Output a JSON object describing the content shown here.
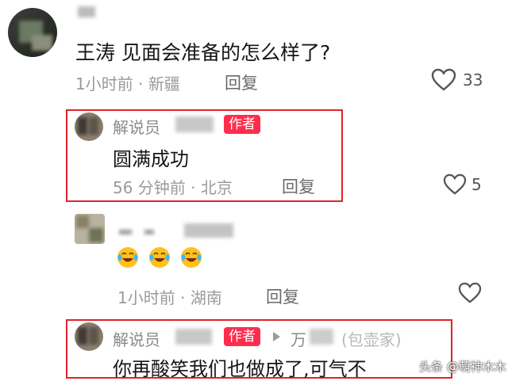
{
  "comments": [
    {
      "text": "王涛 见面会准备的怎么样了?",
      "time": "1小时前",
      "location": "新疆",
      "separator": "·",
      "reply_label": "回复",
      "likes": "33"
    },
    {
      "name": "解说员",
      "author_badge": "作者",
      "text": "圆满成功",
      "time": "56 分钟前",
      "location": "北京",
      "separator": "·",
      "reply_label": "回复",
      "likes": "5"
    },
    {
      "text_emoji_count": 3,
      "time": "1小时前",
      "location": "湖南",
      "separator": "·",
      "reply_label": "回复"
    },
    {
      "name": "解说员",
      "author_badge": "作者",
      "reply_to_prefix": "万",
      "reply_to_suffix": "(包壶家)",
      "text": "你再酸笑我们也做成了,可气不"
    }
  ],
  "watermark": "头条 @萌神木木",
  "icons": {
    "like": "heart-outline-icon",
    "reply_arrow": "triangle-right-icon"
  },
  "colors": {
    "highlight_box": "#e0232c",
    "author_badge": "#ff2d4d"
  }
}
